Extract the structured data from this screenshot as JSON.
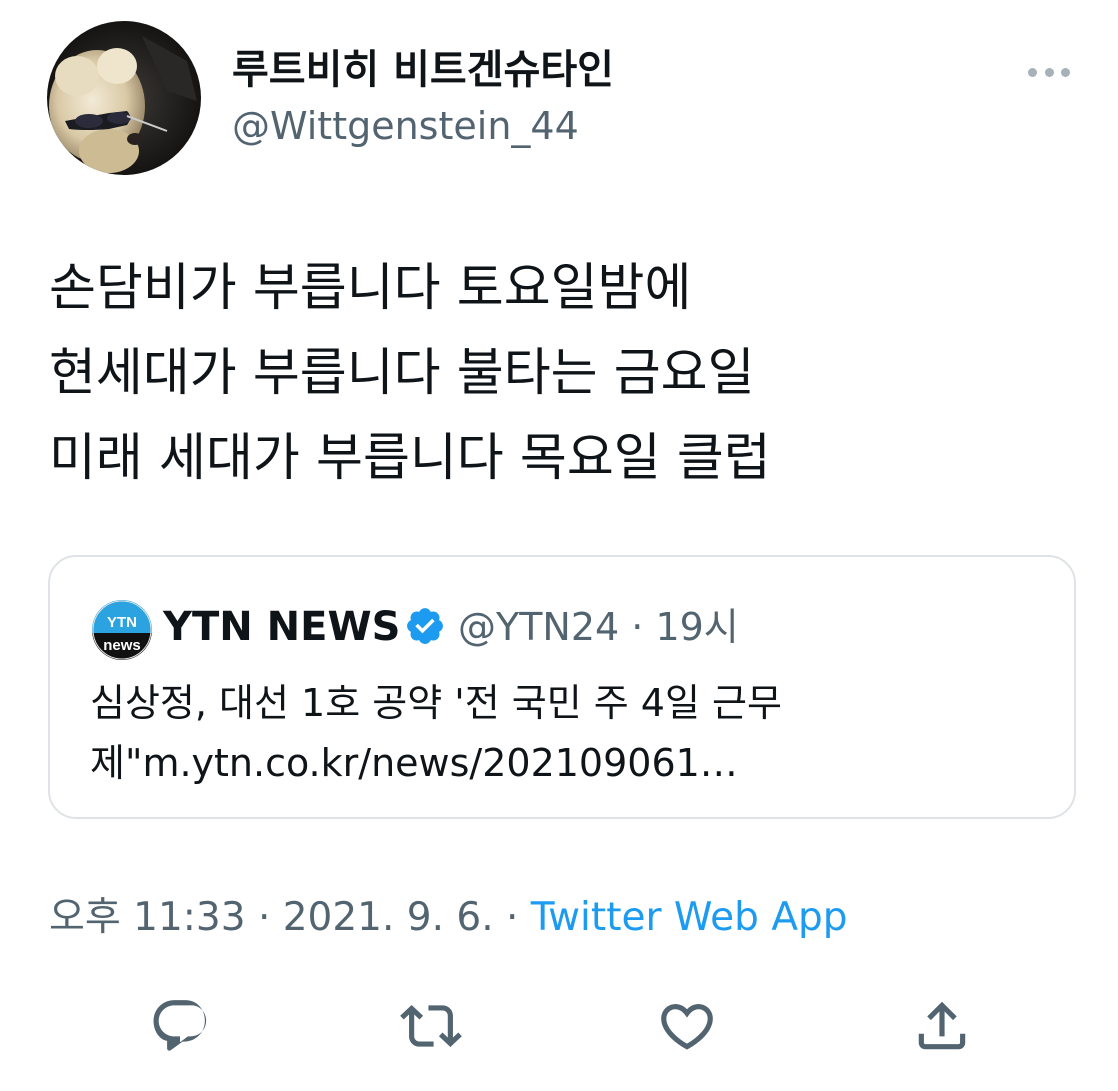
{
  "author": {
    "display_name": "루트비히 비트겐슈타인",
    "handle": "@Wittgenstein_44"
  },
  "more_icon": "more-horizontal-icon",
  "tweet": {
    "lines": [
      "손담비가 부릅니다 토요일밤에",
      "현세대가 부릅니다 불타는 금요일",
      "미래 세대가 부릅니다 목요일 클럽"
    ]
  },
  "quoted": {
    "display_name": "YTN NEWS",
    "handle_time": "@YTN24 · 19시",
    "verified_icon": "verified-badge-icon",
    "logo_text_top": "YTN",
    "logo_text_bottom": "news",
    "lines": [
      "심상정, 대선 1호 공약 '전 국민 주 4일 근무",
      "제\"m.ytn.co.kr/news/202109061…"
    ]
  },
  "meta": {
    "timestamp": "오후 11:33 · 2021. 9. 6. · ",
    "source": "Twitter Web App"
  },
  "colors": {
    "link": "#1d9bf0",
    "secondary_text": "#536471",
    "border": "#dfe3e7",
    "icon": "#536471"
  },
  "actions": [
    "reply-icon",
    "retweet-icon",
    "like-icon",
    "share-icon"
  ]
}
